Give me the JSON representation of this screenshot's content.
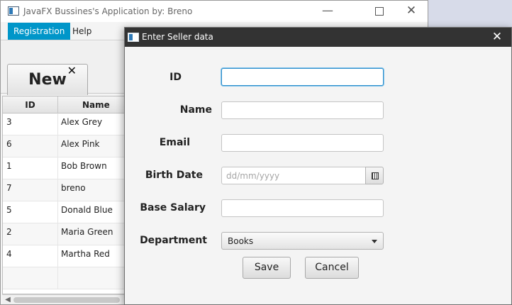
{
  "main_window": {
    "title": "JavaFX Bussines's Application by: Breno",
    "controls": {
      "minimize": "—",
      "maximize": "",
      "close": "✕"
    }
  },
  "menu": {
    "registration": "Registration",
    "help": "Help"
  },
  "toolbar": {
    "new_label": "New",
    "new_close": "✕"
  },
  "table": {
    "columns": [
      "ID",
      "Name"
    ],
    "rows": [
      {
        "id": "3",
        "name": "Alex Grey"
      },
      {
        "id": "6",
        "name": "Alex Pink"
      },
      {
        "id": "1",
        "name": "Bob Brown"
      },
      {
        "id": "7",
        "name": "breno"
      },
      {
        "id": "5",
        "name": "Donald Blue"
      },
      {
        "id": "2",
        "name": "Maria Green"
      },
      {
        "id": "4",
        "name": "Martha Red"
      }
    ]
  },
  "dialog": {
    "title": "Enter Seller data",
    "close": "✕",
    "labels": {
      "id": "ID",
      "name": "Name",
      "email": "Email",
      "birth_date": "Birth Date",
      "base_salary": "Base Salary",
      "department": "Department"
    },
    "values": {
      "id": "",
      "name": "",
      "email": "",
      "base_salary": ""
    },
    "birth_date_placeholder": "dd/mm/yyyy",
    "department_selected": "Books",
    "save_label": "Save",
    "cancel_label": "Cancel"
  },
  "colors": {
    "accent": "#0096c9",
    "dialog_titlebar": "#333333"
  }
}
